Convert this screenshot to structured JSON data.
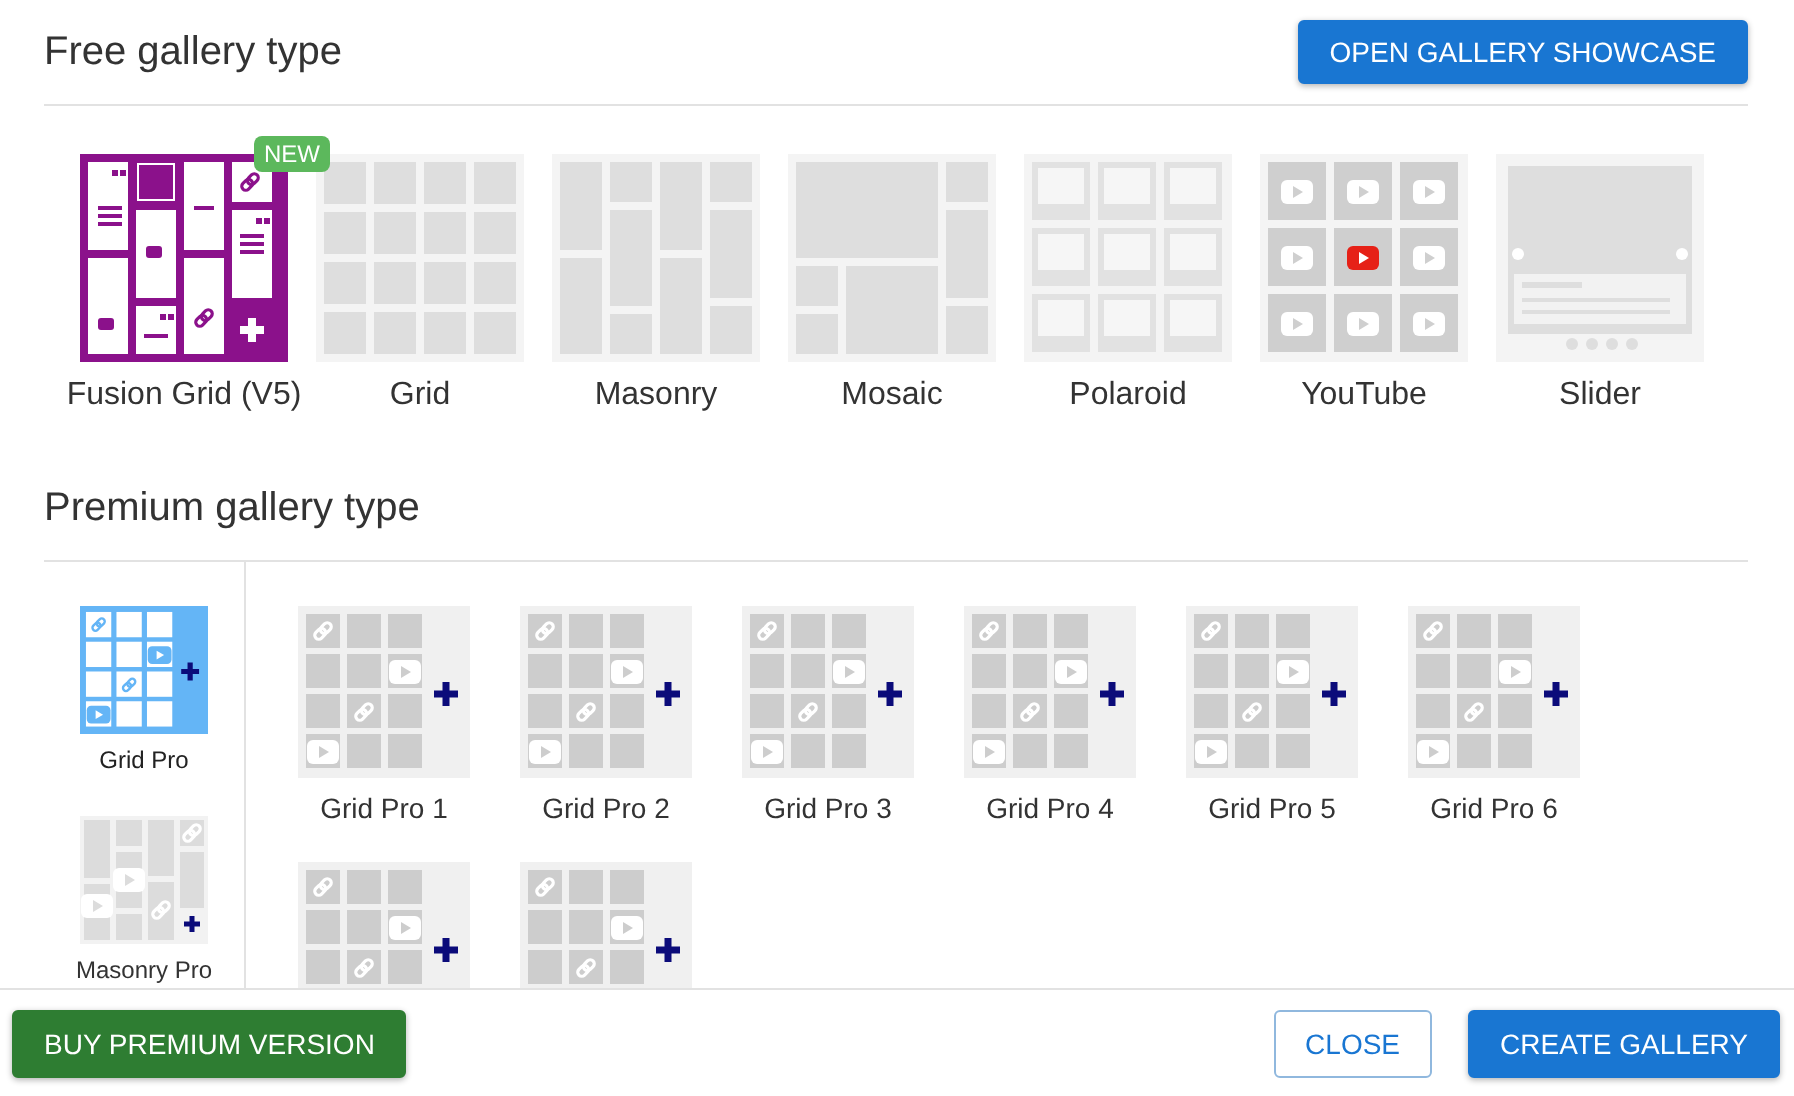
{
  "header": {
    "title": "Free gallery type",
    "showcase_button": "OPEN GALLERY SHOWCASE"
  },
  "free_types": [
    {
      "kind": "fusion",
      "label": "Fusion Grid (V5)",
      "badge": "NEW"
    },
    {
      "kind": "grid",
      "label": "Grid"
    },
    {
      "kind": "masonry",
      "label": "Masonry"
    },
    {
      "kind": "mosaic",
      "label": "Mosaic"
    },
    {
      "kind": "polaroid",
      "label": "Polaroid"
    },
    {
      "kind": "youtube",
      "label": "YouTube"
    },
    {
      "kind": "slider",
      "label": "Slider"
    }
  ],
  "premium": {
    "title": "Premium gallery type",
    "categories": [
      {
        "kind": "gridpro",
        "label": "Grid Pro",
        "selected": true
      },
      {
        "kind": "masonrypro",
        "label": "Masonry Pro",
        "selected": false
      }
    ],
    "layouts": [
      {
        "kind": "gridpro",
        "label": "Grid Pro 1"
      },
      {
        "kind": "gridpro",
        "label": "Grid Pro 2"
      },
      {
        "kind": "gridpro",
        "label": "Grid Pro 3"
      },
      {
        "kind": "gridpro",
        "label": "Grid Pro 4"
      },
      {
        "kind": "gridpro",
        "label": "Grid Pro 5"
      },
      {
        "kind": "gridpro",
        "label": "Grid Pro 6"
      },
      {
        "kind": "gridpro"
      },
      {
        "kind": "gridpro"
      }
    ]
  },
  "footer": {
    "buy_button": "BUY PREMIUM VERSION",
    "close_button": "CLOSE",
    "create_button": "CREATE GALLERY"
  }
}
